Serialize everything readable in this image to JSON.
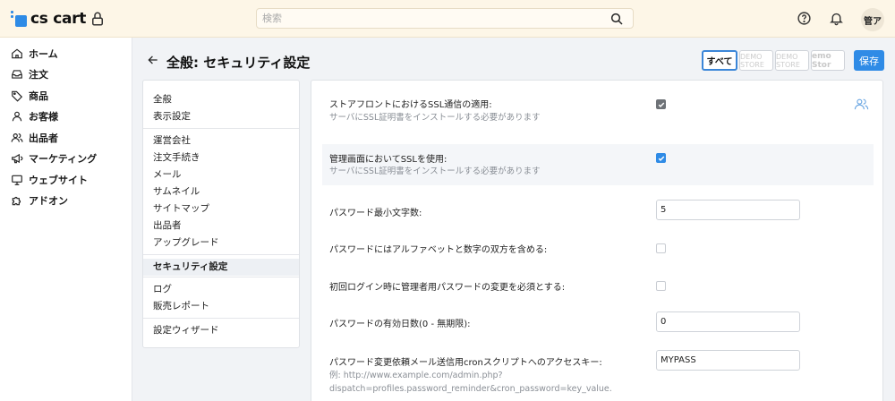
{
  "header": {
    "logo_text": "cs cart",
    "search_placeholder": "検索",
    "avatar_text": "管ア"
  },
  "sidebar": {
    "items": [
      {
        "label": "ホーム",
        "icon": "home-icon"
      },
      {
        "label": "注文",
        "icon": "inbox-icon"
      },
      {
        "label": "商品",
        "icon": "tag-icon"
      },
      {
        "label": "お客様",
        "icon": "user-icon"
      },
      {
        "label": "出品者",
        "icon": "users-icon"
      },
      {
        "label": "マーケティング",
        "icon": "megaphone-icon"
      },
      {
        "label": "ウェブサイト",
        "icon": "monitor-icon"
      },
      {
        "label": "アドオン",
        "icon": "puzzle-icon"
      }
    ]
  },
  "page": {
    "title": "全般: セキュリティ設定",
    "storefronts": {
      "all_label": "すべて",
      "demo_label": "DEMO STORE",
      "demo3_label": "emo Stor"
    },
    "save_label": "保存"
  },
  "tabs": {
    "group1": [
      "全般",
      "表示設定"
    ],
    "group2": [
      "運営会社",
      "注文手続き",
      "メール",
      "サムネイル",
      "サイトマップ",
      "出品者",
      "アップグレード"
    ],
    "active": "セキュリティ設定",
    "group3": [
      "ログ",
      "販売レポート"
    ],
    "group4": [
      "設定ウィザード"
    ]
  },
  "settings": {
    "ssl_storefront": {
      "label": "ストアフロントにおけるSSL通信の適用:",
      "hint": "サーバにSSL証明書をインストールする必要があります",
      "checked": true
    },
    "ssl_admin": {
      "label": "管理画面においてSSLを使用:",
      "hint": "サーバにSSL証明書をインストールする必要があります",
      "checked": true
    },
    "pwd_min_length": {
      "label": "パスワード最小文字数:",
      "value": "5"
    },
    "pwd_alnum": {
      "label": "パスワードにはアルファベットと数字の双方を含める:",
      "checked": false
    },
    "pwd_change_first": {
      "label": "初回ログイン時に管理者用パスワードの変更を必須とする:",
      "checked": false
    },
    "pwd_days": {
      "label": "パスワードの有効日数(0 - 無期限):",
      "value": "0"
    },
    "cron_key": {
      "label": "パスワード変更依頼メール送信用cronスクリプトへのアクセスキー:",
      "hint1": "例: http://www.example.com/admin.php?",
      "hint2": "dispatch=profiles.password_reminder&cron_password=key_value.",
      "value": "MYPASS"
    }
  },
  "colors": {
    "topbar_bg": "#fdf6e7",
    "accent": "#2f8be6"
  }
}
